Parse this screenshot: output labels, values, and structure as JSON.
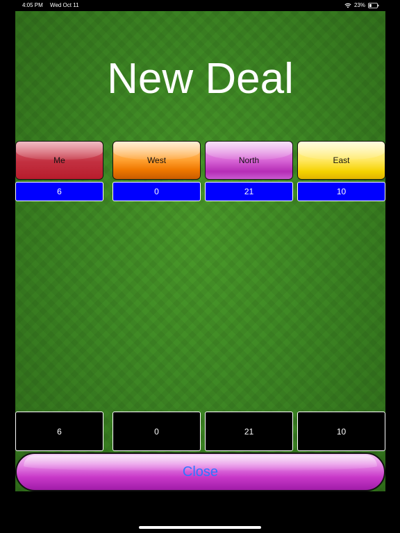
{
  "status_bar": {
    "time": "4:05 PM",
    "date": "Wed Oct 11",
    "battery_percent": "23%",
    "icons": [
      "wifi-icon",
      "battery-icon"
    ]
  },
  "title": "New Deal",
  "players": [
    {
      "name": "Me",
      "score_top": "6",
      "score_bottom": "6",
      "color": "#b81c2c"
    },
    {
      "name": "West",
      "score_top": "0",
      "score_bottom": "0",
      "color": "#f07800"
    },
    {
      "name": "North",
      "score_top": "21",
      "score_bottom": "21",
      "color": "#b52cb6"
    },
    {
      "name": "East",
      "score_top": "10",
      "score_bottom": "10",
      "color": "#f5d200"
    }
  ],
  "close_button": {
    "label": "Close",
    "text_color": "#2f76ff"
  },
  "colors": {
    "felt": "#3f8a25",
    "score_bar": "#0000ff",
    "score_box": "#000000"
  }
}
